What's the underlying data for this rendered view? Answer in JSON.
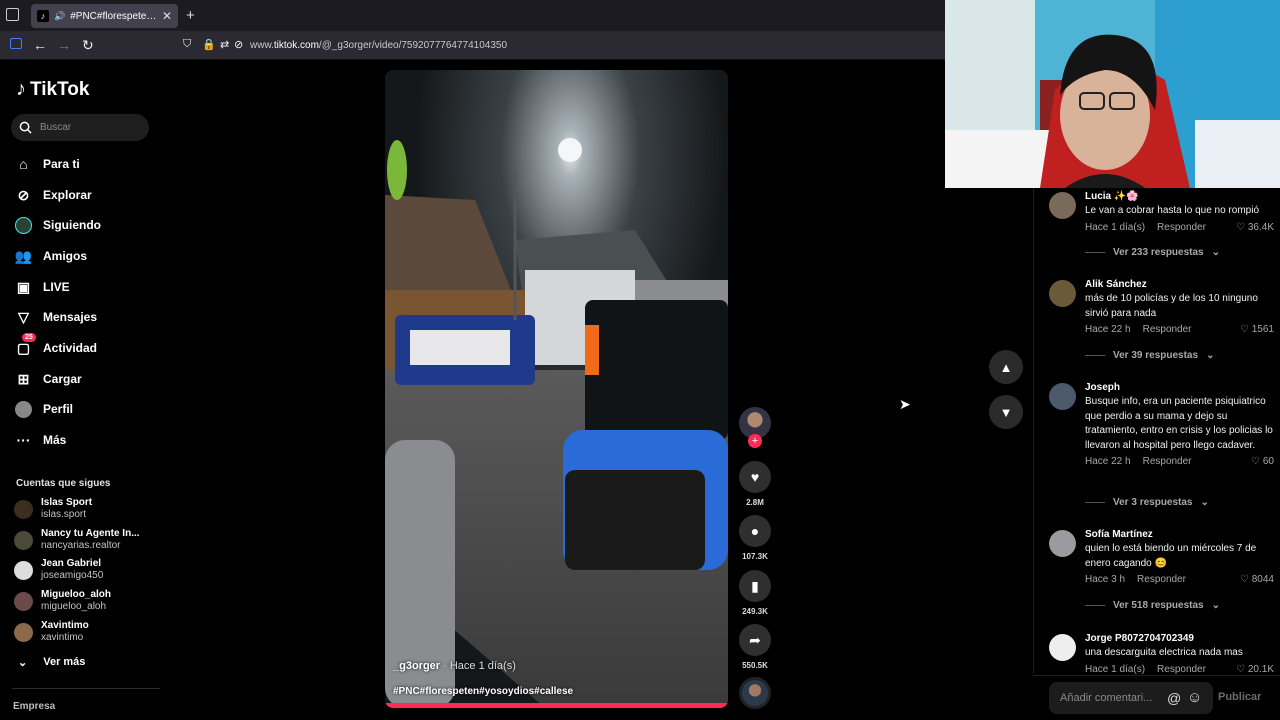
{
  "browser": {
    "tab_title": "#PNC#florespeten#yosoydi",
    "url_prefix": "www.",
    "url_domain": "tiktok.com",
    "url_path": "/@_g3orger/video/7592077764774104350"
  },
  "sidebar": {
    "brand": "TikTok",
    "search_placeholder": "Buscar",
    "nav": [
      {
        "label": "Para ti",
        "icon": "home-icon"
      },
      {
        "label": "Explorar",
        "icon": "compass-icon"
      },
      {
        "label": "Siguiendo",
        "icon": "following-icon"
      },
      {
        "label": "Amigos",
        "icon": "friends-icon"
      },
      {
        "label": "LIVE",
        "icon": "live-icon"
      },
      {
        "label": "Mensajes",
        "icon": "messages-icon"
      },
      {
        "label": "Actividad",
        "icon": "activity-icon",
        "badge": "25"
      },
      {
        "label": "Cargar",
        "icon": "upload-icon"
      },
      {
        "label": "Perfil",
        "icon": "profile-icon"
      },
      {
        "label": "Más",
        "icon": "more-icon"
      }
    ],
    "following_title": "Cuentas que sigues",
    "following": [
      {
        "name": "Islas Sport",
        "handle": "islas.sport"
      },
      {
        "name": "Nancy tu Agente In...",
        "handle": "nancyarias.realtor"
      },
      {
        "name": "Jean Gabriel",
        "handle": "joseamigo450"
      },
      {
        "name": "Migueloo_aloh",
        "handle": "migueloo_aloh"
      },
      {
        "name": "Xavintimo",
        "handle": "xavintimo"
      }
    ],
    "see_more": "Ver más",
    "footer": "Empresa"
  },
  "video": {
    "author": "_g3orger",
    "time": " · Hace 1 día(s)",
    "caption": "#PNC#florespeten#yosoydios#callese"
  },
  "actions": {
    "likes": "2.8M",
    "comments": "107.3K",
    "saves": "249.3K",
    "shares": "550.5K"
  },
  "comments": [
    {
      "name": "Lucia ✨🌸",
      "text": "Le van a cobrar hasta lo que no rompió",
      "time": "Hace 1 día(s)",
      "reply": "Responder",
      "likes": "36.4K",
      "replies": "Ver 233 respuestas"
    },
    {
      "name": "Alik Sánchez",
      "text": "más de 10 policías y de los 10 ninguno sirvió para nada",
      "time": "Hace 22 h",
      "reply": "Responder",
      "likes": "1561",
      "replies": "Ver 39 respuestas"
    },
    {
      "name": "Joseph",
      "text": "Busque info, era un paciente psiquiatrico que perdio a su mama y dejo su tratamiento, entro en crisis y los policias lo llevaron al hospital pero llego cadaver.",
      "time": "Hace 22 h",
      "reply": "Responder",
      "likes": "60",
      "replies": "Ver 3 respuestas"
    },
    {
      "name": "Sofía Martínez",
      "text": "quien lo está biendo un miércoles 7 de enero cagando 😊",
      "time": "Hace 3 h",
      "reply": "Responder",
      "likes": "8044",
      "replies": "Ver 518 respuestas"
    },
    {
      "name": "Jorge P8072704702349",
      "text": "una descarguita electrica nada mas",
      "time": "Hace 1 día(s)",
      "reply": "Responder",
      "likes": "20.1K"
    }
  ],
  "comment_input": {
    "placeholder": "Añadir comentari...",
    "publish": "Publicar"
  }
}
